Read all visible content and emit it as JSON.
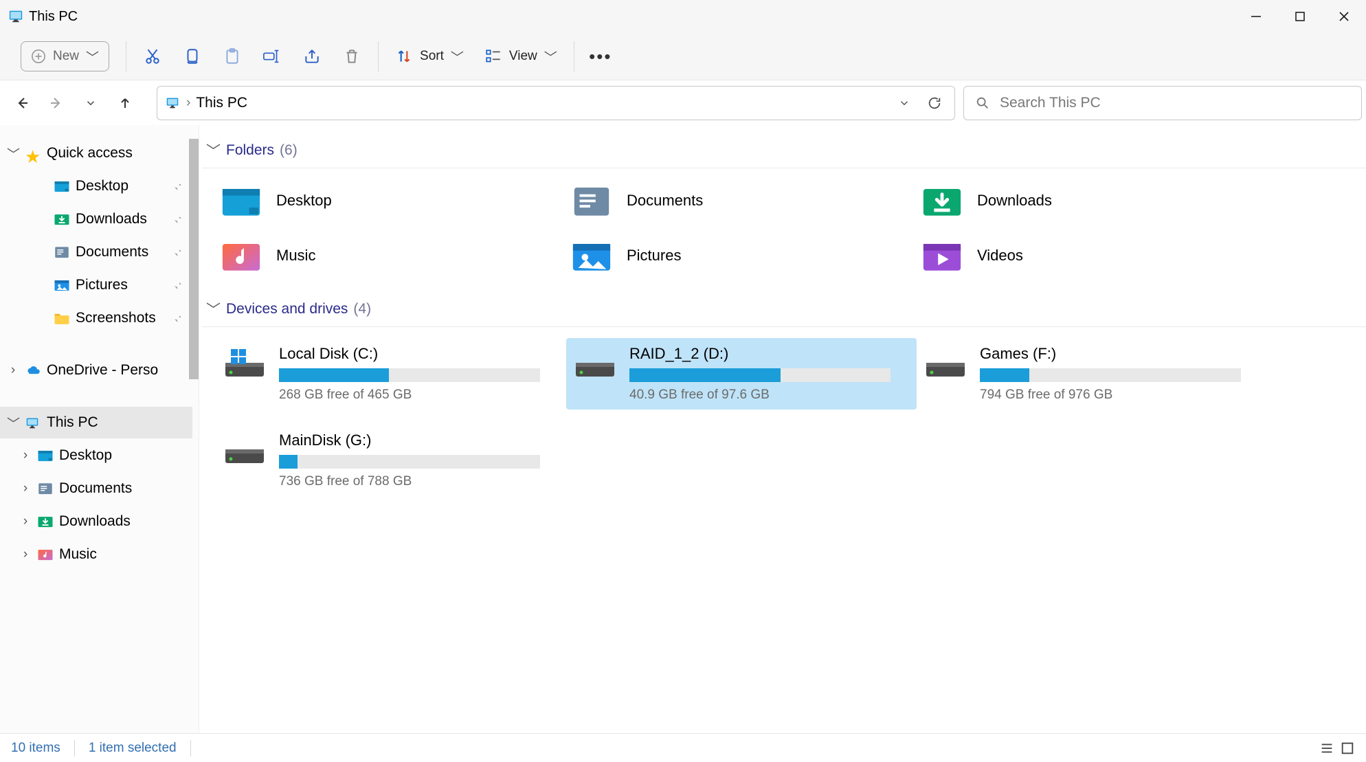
{
  "title": "This PC",
  "commandbar": {
    "new_label": "New",
    "sort_label": "Sort",
    "view_label": "View"
  },
  "address": {
    "location": "This PC"
  },
  "search": {
    "placeholder": "Search This PC"
  },
  "sidebar": {
    "quick_access": {
      "label": "Quick access",
      "items": [
        {
          "label": "Desktop",
          "kind": "desktop",
          "pinned": true
        },
        {
          "label": "Downloads",
          "kind": "downloads",
          "pinned": true
        },
        {
          "label": "Documents",
          "kind": "documents",
          "pinned": true
        },
        {
          "label": "Pictures",
          "kind": "pictures",
          "pinned": true
        },
        {
          "label": "Screenshots",
          "kind": "screenshots",
          "pinned": true
        }
      ]
    },
    "onedrive": {
      "label": "OneDrive - Perso"
    },
    "this_pc": {
      "label": "This PC",
      "items": [
        {
          "label": "Desktop",
          "kind": "desktop"
        },
        {
          "label": "Documents",
          "kind": "documents"
        },
        {
          "label": "Downloads",
          "kind": "downloads"
        },
        {
          "label": "Music",
          "kind": "music"
        }
      ]
    }
  },
  "groups": {
    "folders": {
      "label": "Folders",
      "count": "(6)",
      "items": [
        {
          "name": "Desktop",
          "kind": "desktop"
        },
        {
          "name": "Documents",
          "kind": "documents"
        },
        {
          "name": "Downloads",
          "kind": "downloads"
        },
        {
          "name": "Music",
          "kind": "music"
        },
        {
          "name": "Pictures",
          "kind": "pictures"
        },
        {
          "name": "Videos",
          "kind": "videos"
        }
      ]
    },
    "drives": {
      "label": "Devices and drives",
      "count": "(4)",
      "items": [
        {
          "name": "Local Disk (C:)",
          "free": "268 GB free of 465 GB",
          "used_pct": 42,
          "selected": false,
          "osdrive": true
        },
        {
          "name": "RAID_1_2 (D:)",
          "free": "40.9 GB free of 97.6 GB",
          "used_pct": 58,
          "selected": true,
          "osdrive": false
        },
        {
          "name": "Games (F:)",
          "free": "794 GB free of 976 GB",
          "used_pct": 19,
          "selected": false,
          "osdrive": false
        },
        {
          "name": "MainDisk (G:)",
          "free": "736 GB free of 788 GB",
          "used_pct": 7,
          "selected": false,
          "osdrive": false
        }
      ]
    }
  },
  "status": {
    "items": "10 items",
    "selected": "1 item selected"
  }
}
